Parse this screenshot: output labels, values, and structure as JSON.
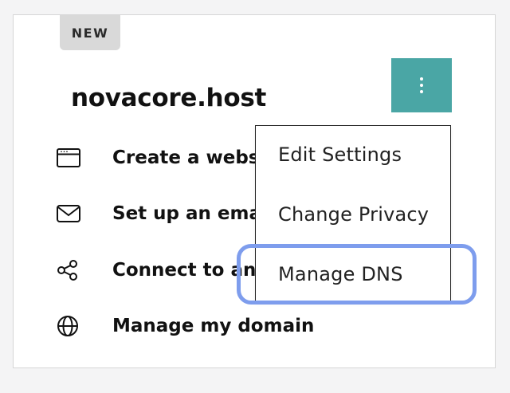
{
  "card": {
    "badge": "NEW",
    "domain_name": "novacore.host"
  },
  "kebab_menu": {
    "icon": "vertical-dots-icon",
    "color": "#4aa6a5"
  },
  "actions": [
    {
      "label": "Create a websi",
      "icon": "browser-window-icon"
    },
    {
      "label": "Set up an emai",
      "icon": "envelope-icon"
    },
    {
      "label": "Connect to an",
      "icon": "share-icon"
    },
    {
      "label": "Manage my domain",
      "icon": "globe-icon"
    }
  ],
  "dropdown": {
    "items": [
      {
        "label": "Edit Settings"
      },
      {
        "label": "Change Privacy"
      },
      {
        "label": "Manage DNS",
        "highlighted": true
      }
    ],
    "highlight_color": "#7e9ded"
  }
}
